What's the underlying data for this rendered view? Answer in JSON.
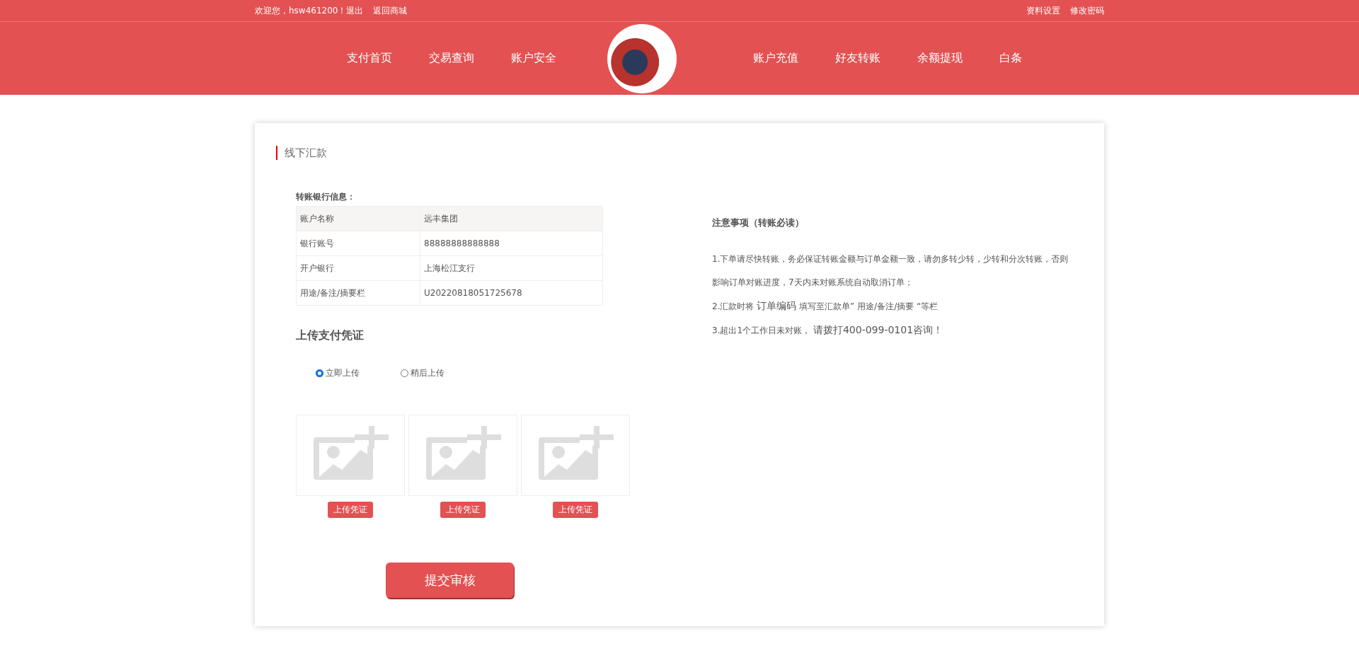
{
  "top_bar": {
    "welcome": "欢迎您，hsw461200！退出",
    "back_link": "返回商城",
    "right_links": [
      "资料设置",
      "修改密码"
    ]
  },
  "nav": {
    "left": [
      "支付首页",
      "交易查询",
      "账户安全"
    ],
    "right": [
      "账户充值",
      "好友转账",
      "余额提现",
      "白条"
    ]
  },
  "card": {
    "title": "线下汇款",
    "bank": {
      "heading": "转账银行信息：",
      "rows": [
        {
          "label": "账户名称",
          "value": "远丰集团"
        },
        {
          "label": "银行账号",
          "value": "88888888888888"
        },
        {
          "label": "开户银行",
          "value": "上海松江支行"
        },
        {
          "label": "用途/备注/摘要栏",
          "value": "U20220818051725678"
        }
      ]
    },
    "upload": {
      "heading": "上传支付凭证",
      "options": [
        {
          "label": "立即上传",
          "selected": true
        },
        {
          "label": "稍后上传",
          "selected": false
        }
      ],
      "slots": [
        {
          "button": "上传凭证"
        },
        {
          "button": "上传凭证"
        },
        {
          "button": "上传凭证"
        }
      ]
    },
    "submit": "提交审核",
    "notes": {
      "heading": "注意事项（转账必读）",
      "items": [
        {
          "parts": [
            {
              "text": "1.下单请尽快转账，务必保证转账金额与订单金额一致，请勿多转少转，少转和分次转账，否则影响订单对账进度，7天内未对账系统自动取消订单；",
              "large": false
            }
          ]
        },
        {
          "parts": [
            {
              "text": "2.汇款时将 ",
              "large": false
            },
            {
              "text": "订单编码",
              "large": true
            },
            {
              "text": " 填写至汇款单” 用途/备注/摘要 “等栏",
              "large": false
            }
          ]
        },
        {
          "parts": [
            {
              "text": "3.超出1个工作日未对账， ",
              "large": false
            },
            {
              "text": "请拨打400-099-0101咨询！",
              "large": true
            }
          ]
        }
      ]
    }
  }
}
